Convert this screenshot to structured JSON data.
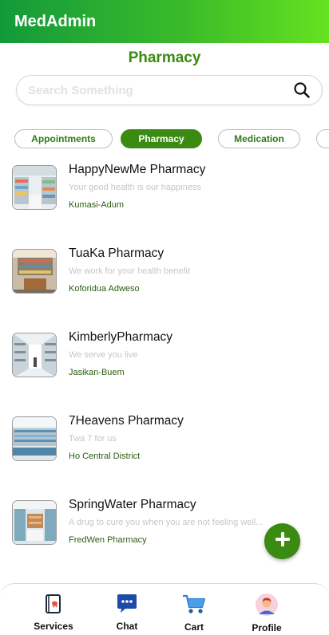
{
  "app": {
    "title": "MedAdmin",
    "accent": "#3b8a12"
  },
  "page": {
    "title": "Pharmacy"
  },
  "search": {
    "placeholder": "Search Something",
    "value": ""
  },
  "tabs": [
    {
      "label": "Appointments",
      "active": false
    },
    {
      "label": "Pharmacy",
      "active": true
    },
    {
      "label": "Medication",
      "active": false
    },
    {
      "label": "",
      "active": false
    }
  ],
  "pharmacies": [
    {
      "name": "HappyNewMe Pharmacy",
      "tagline": "Your good health is our happiness",
      "location": "Kumasi-Adum"
    },
    {
      "name": "TuaKa Pharmacy",
      "tagline": "We work for your health benefit",
      "location": "Koforidua Adweso"
    },
    {
      "name": "KimberlyPharmacy",
      "tagline": "We serve you live",
      "location": "Jasikan-Buem"
    },
    {
      "name": "7Heavens Pharmacy",
      "tagline": "Twa 7 for us",
      "location": "Ho Central District"
    },
    {
      "name": "SpringWater Pharmacy",
      "tagline": "A drug to cure you when you are not feeling well...",
      "location": "FredWen Pharmacy"
    }
  ],
  "fab": {
    "icon": "plus-icon"
  },
  "nav": [
    {
      "label": "Services",
      "icon": "medical-book-icon"
    },
    {
      "label": "Chat",
      "icon": "chat-icon"
    },
    {
      "label": "Cart",
      "icon": "cart-icon"
    },
    {
      "label": "Profile",
      "icon": "avatar-icon"
    }
  ]
}
